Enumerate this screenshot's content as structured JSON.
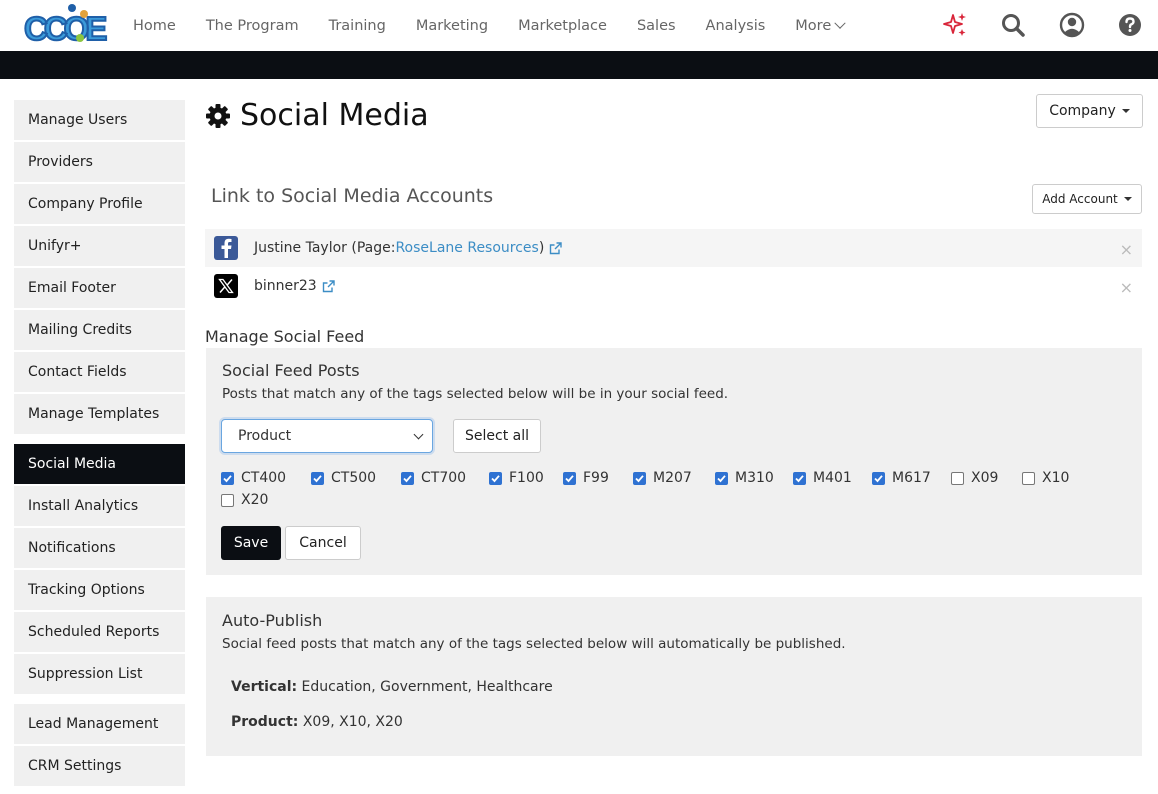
{
  "nav": {
    "logo_text": "CCOE",
    "items": [
      "Home",
      "The Program",
      "Training",
      "Marketing",
      "Marketplace",
      "Sales",
      "Analysis",
      "More"
    ],
    "icons": [
      "sparkle-icon",
      "search-icon",
      "user-icon",
      "help-icon"
    ],
    "colors": {
      "sparkle": "#d9263a",
      "icons": "#555555"
    }
  },
  "sidebar": {
    "group1": [
      "Manage Users",
      "Providers",
      "Company Profile",
      "Unifyr+",
      "Email Footer",
      "Mailing Credits",
      "Contact Fields",
      "Manage Templates"
    ],
    "group2": [
      "Social Media",
      "Install Analytics",
      "Notifications",
      "Tracking Options",
      "Scheduled Reports",
      "Suppression List"
    ],
    "group3": [
      "Lead Management",
      "CRM Settings"
    ],
    "active": "Social Media"
  },
  "page": {
    "title": "Social Media",
    "company_button": "Company"
  },
  "accounts": {
    "heading": "Link to Social Media Accounts",
    "add_button": "Add Account",
    "items": [
      {
        "network": "facebook",
        "prefix": "Justine Taylor (Page: ",
        "link": "RoseLane Resources",
        "suffix": ")"
      },
      {
        "network": "x",
        "prefix": "",
        "link": "binner23",
        "suffix": ""
      }
    ],
    "remove_glyph": "×"
  },
  "feed": {
    "label": "Manage Social Feed",
    "posts_title": "Social Feed Posts",
    "posts_desc": "Posts that match any of the tags selected below will be in your social feed.",
    "select_value": "Product",
    "select_all": "Select all",
    "tags": [
      {
        "label": "CT400",
        "checked": true
      },
      {
        "label": "CT500",
        "checked": true
      },
      {
        "label": "CT700",
        "checked": true
      },
      {
        "label": "F100",
        "checked": true
      },
      {
        "label": "F99",
        "checked": true
      },
      {
        "label": "M207",
        "checked": true
      },
      {
        "label": "M310",
        "checked": true
      },
      {
        "label": "M401",
        "checked": true
      },
      {
        "label": "M617",
        "checked": true
      },
      {
        "label": "X09",
        "checked": false
      },
      {
        "label": "X10",
        "checked": false
      },
      {
        "label": "X20",
        "checked": false
      }
    ],
    "save": "Save",
    "cancel": "Cancel"
  },
  "autopublish": {
    "title": "Auto-Publish",
    "desc": "Social feed posts that match any of the tags selected below will automatically be published.",
    "vertical_label": "Vertical:",
    "vertical_value": " Education, Government, Healthcare",
    "product_label": "Product:",
    "product_value": " X09, X10, X20"
  }
}
